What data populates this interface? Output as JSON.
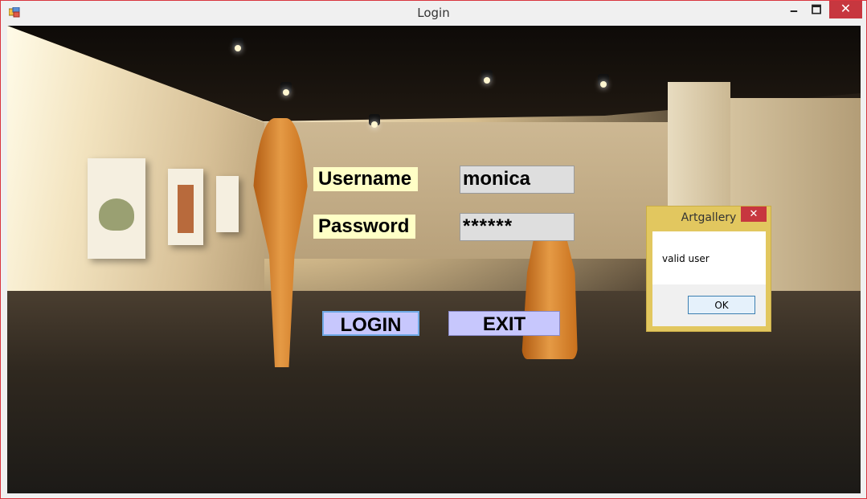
{
  "window": {
    "title": "Login",
    "minimize_glyph": "🗕",
    "maximize_glyph": "🗖",
    "close_glyph": "✕"
  },
  "form": {
    "username_label": "Username",
    "username_value": "monica",
    "password_label": "Password",
    "password_value": "******",
    "login_button": "LOGIN",
    "exit_button": "EXIT"
  },
  "dialog": {
    "title": "Artgallery",
    "message": "valid user",
    "ok_button": "OK",
    "close_glyph": "✕"
  },
  "colors": {
    "label_bg": "#ffffc6",
    "button_bg": "#c7c7fd",
    "dialog_frame": "#e2c75f",
    "close_red": "#c7373f"
  }
}
